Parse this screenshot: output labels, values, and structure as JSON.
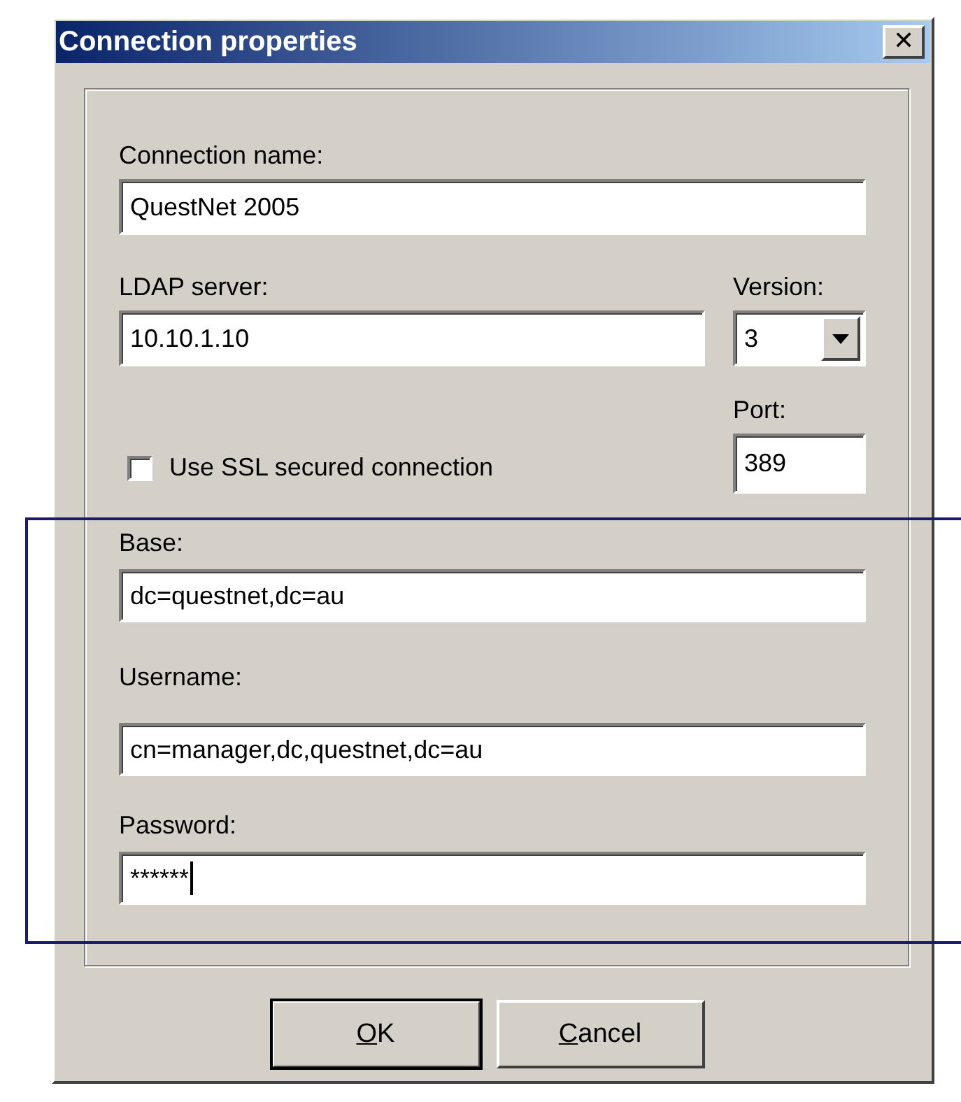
{
  "window": {
    "title": "Connection properties",
    "close": "✕"
  },
  "fields": [
    {
      "label": "Connection name:",
      "value": "QuestNet 2005"
    },
    {
      "label": "LDAP server:",
      "value": "10.10.1.10"
    }
  ],
  "version": {
    "label": "Version:",
    "value": "3"
  },
  "port": {
    "label": "Port:",
    "value": "389"
  },
  "ssl": {
    "label": "Use SSL secured connection",
    "checked": false
  },
  "auth_fields": [
    {
      "label": "Base:",
      "value": "dc=questnet,dc=au"
    },
    {
      "label": "Username:",
      "value": "cn=manager,dc,questnet,dc=au"
    }
  ],
  "password": {
    "label": "Password:",
    "value": "******",
    "focused": true
  },
  "buttons": [
    {
      "label": "OK",
      "default": true
    },
    {
      "label": "Cancel",
      "default": false
    }
  ]
}
